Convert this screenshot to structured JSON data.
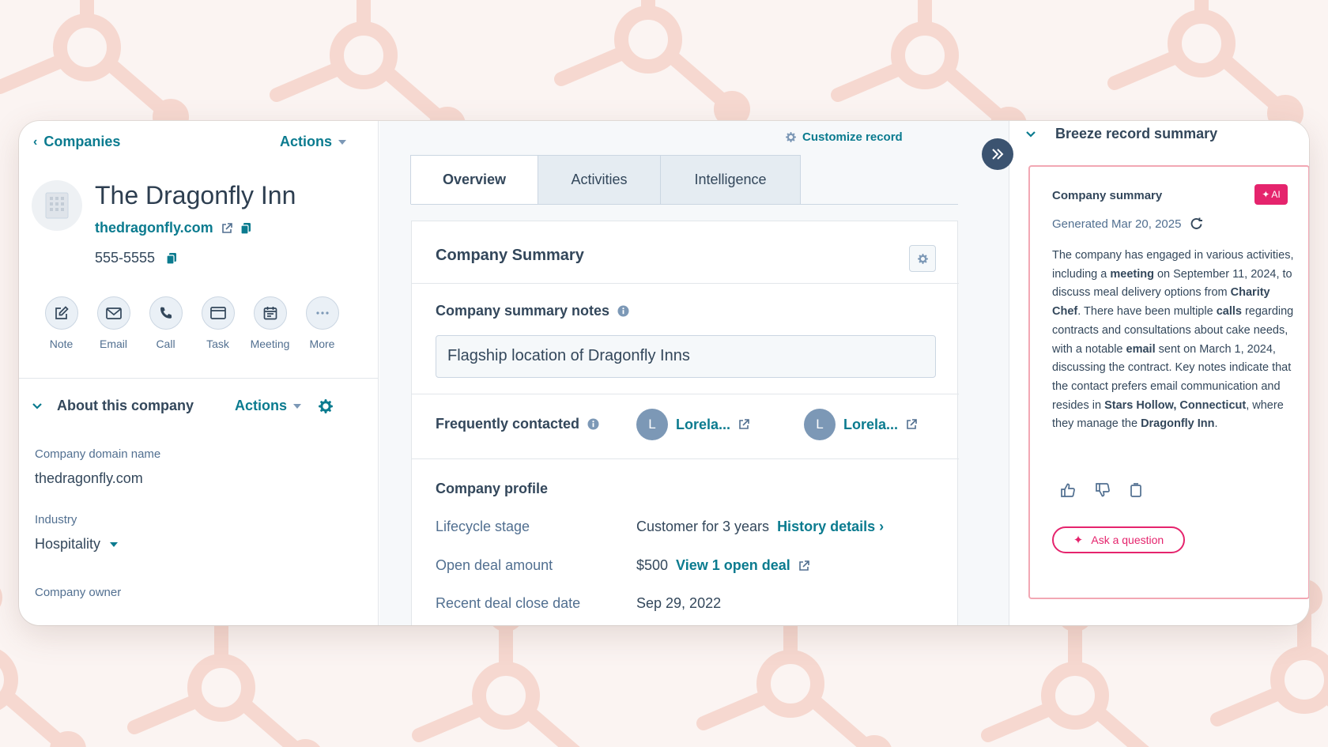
{
  "header": {
    "back_label": "Companies",
    "actions_label": "Actions"
  },
  "company": {
    "name": "The Dragonfly Inn",
    "domain": "thedragonfly.com",
    "phone": "555-5555"
  },
  "quick_actions": [
    "Note",
    "Email",
    "Call",
    "Task",
    "Meeting",
    "More"
  ],
  "about": {
    "title": "About this company",
    "actions_label": "Actions",
    "properties": [
      {
        "label": "Company domain name",
        "value": "thedragonfly.com"
      },
      {
        "label": "Industry",
        "value": "Hospitality"
      },
      {
        "label": "Company owner",
        "value": ""
      }
    ]
  },
  "toolbar": {
    "customize_label": "Customize record"
  },
  "tabs": [
    {
      "label": "Overview",
      "active": true
    },
    {
      "label": "Activities",
      "active": false
    },
    {
      "label": "Intelligence",
      "active": false
    }
  ],
  "summary_card": {
    "title": "Company Summary",
    "notes_label": "Company summary notes",
    "notes_value": "Flagship location of Dragonfly Inns",
    "frequently_contacted_label": "Frequently contacted",
    "contacts": [
      {
        "initial": "L",
        "name": "Lorela..."
      },
      {
        "initial": "L",
        "name": "Lorela..."
      }
    ],
    "profile_title": "Company profile",
    "profile_rows": [
      {
        "label": "Lifecycle stage",
        "value": "Customer for 3 years",
        "link": "History details ›"
      },
      {
        "label": "Open deal amount",
        "value": "$500",
        "link": "View 1 open deal"
      },
      {
        "label": "Recent deal close date",
        "value": "Sep 29, 2022",
        "link": ""
      }
    ]
  },
  "breeze": {
    "title": "Breeze record summary",
    "card_title": "Company summary",
    "badge": "AI",
    "generated": "Generated Mar 20, 2025",
    "summary": [
      {
        "t": "The company has engaged in various activities, including a ",
        "b": false
      },
      {
        "t": "meeting",
        "b": true
      },
      {
        "t": " on September 11, 2024, to discuss meal delivery options from ",
        "b": false
      },
      {
        "t": "Charity Chef",
        "b": true
      },
      {
        "t": ". There have been multiple ",
        "b": false
      },
      {
        "t": "calls",
        "b": true
      },
      {
        "t": " regarding contracts and consultations about cake needs, with a notable ",
        "b": false
      },
      {
        "t": "email",
        "b": true
      },
      {
        "t": " sent on March 1, 2024, discussing the contract. Key notes indicate that the contact prefers email communication and resides in ",
        "b": false
      },
      {
        "t": "Stars Hollow, Connecticut",
        "b": true
      },
      {
        "t": ", where they manage the ",
        "b": false
      },
      {
        "t": "Dragonfly Inn",
        "b": true
      },
      {
        "t": ".",
        "b": false
      }
    ],
    "ask_label": "Ask a question"
  },
  "colors": {
    "link": "#0b7b8f",
    "ai_accent": "#e5246d",
    "brand_pattern": "#f4c9be"
  },
  "icons": [
    "external-link-icon",
    "copy-icon",
    "note-icon",
    "email-icon",
    "call-icon",
    "task-icon",
    "meeting-icon",
    "more-icon",
    "gear-icon",
    "info-icon",
    "thumbs-up-icon",
    "thumbs-down-icon",
    "regenerate-icon",
    "sparkle-icon",
    "double-chevron-right-icon"
  ]
}
